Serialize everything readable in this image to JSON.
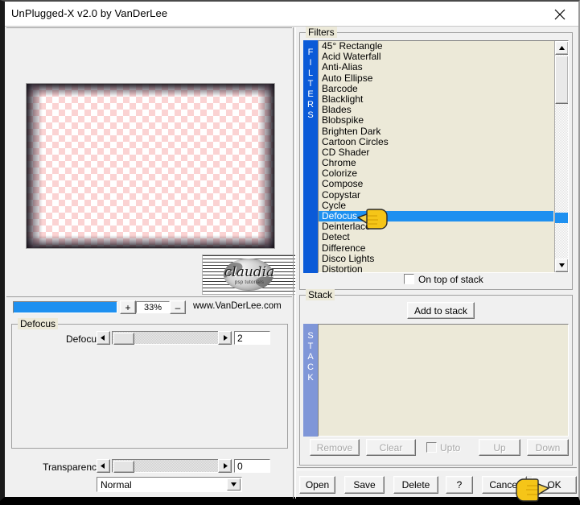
{
  "window": {
    "title": "UnPlugged-X v2.0 by VanDerLee",
    "close_icon": "close-icon"
  },
  "preview": {
    "zoom_percent": "33%",
    "zoom_in_label": "+",
    "zoom_out_label": "–",
    "website": "www.VanDerLee.com",
    "watermark_text": "claudia",
    "watermark_sub": "psp tutorials"
  },
  "params": {
    "group_label": "Defocus",
    "defocus": {
      "label": "Defocus",
      "value": "2",
      "left_arrow": "◄",
      "right_arrow": "►"
    },
    "transparency": {
      "label": "Transparency",
      "value": "0",
      "left_arrow": "◄",
      "right_arrow": "►"
    },
    "blend_mode": {
      "value": "Normal",
      "arrow": "▼"
    }
  },
  "filters": {
    "group_label": "Filters",
    "strip_label": "FILTERS",
    "selected": "Defocus",
    "items": [
      "45° Rectangle",
      "Acid Waterfall",
      "Anti-Alias",
      "Auto Ellipse",
      "Barcode",
      "Blacklight",
      "Blades",
      "Blobspike",
      "Brighten Dark",
      "Cartoon Circles",
      "CD Shader",
      "Chrome",
      "Colorize",
      "Compose",
      "Copystar",
      "Cycle",
      "Defocus",
      "Deinterlace",
      "Detect",
      "Difference",
      "Disco Lights",
      "Distortion"
    ],
    "scroll_up_icon": "▲",
    "scroll_down_icon": "▼",
    "on_top_of_stack": {
      "label": "On top of stack",
      "checked": false
    }
  },
  "stack": {
    "group_label": "Stack",
    "strip_label": "STACK",
    "add_button": "Add to stack",
    "items": [],
    "controls": [
      {
        "name": "remove-button",
        "label": "Remove",
        "disabled": true
      },
      {
        "name": "clear-button",
        "label": "Clear",
        "disabled": true
      },
      {
        "name": "up-button",
        "label": "Up",
        "disabled": true
      },
      {
        "name": "down-button",
        "label": "Down",
        "disabled": true
      }
    ],
    "upto": {
      "label": "Upto",
      "checked": false,
      "disabled": true
    }
  },
  "footer": {
    "open": "Open",
    "save": "Save",
    "delete": "Delete",
    "help": "?",
    "cancel": "Cancel",
    "ok": "OK"
  },
  "colors": {
    "accent_blue": "#1e90f0",
    "panel_beige": "#ece9d8",
    "stack_strip_blue": "#7f96d8",
    "window_gray": "#f0f0f0"
  }
}
